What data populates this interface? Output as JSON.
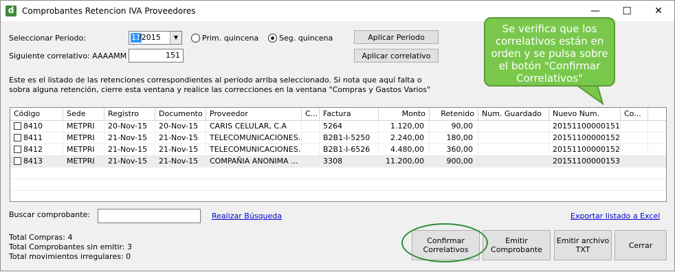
{
  "window": {
    "title": "Comprobantes Retencion IVA Proveedores",
    "app_icon_letter": "d",
    "min_glyph": "—",
    "max_glyph": "☐",
    "close_glyph": "✕"
  },
  "period": {
    "label": "Seleccionar Periodo:",
    "month_selected": "11",
    "year_rest": "/2015",
    "option_first": "Prim. quincena",
    "option_second": "Seg. quincena",
    "selected_option": "second",
    "apply_label": "Aplicar Periodo"
  },
  "correlative": {
    "label": "Siguiente correlativo: AAAAMM",
    "value": "151",
    "apply_label": "Aplicar correlativo"
  },
  "info": {
    "line1": "Este es el listado de las retenciones correspondientes al período arriba seleccionado. Si nota que aquí falta o",
    "line2": "sobra alguna retención, cierre esta ventana y realice las correcciones en la ventana \"Compras y Gastos Varios\""
  },
  "table": {
    "columns": [
      "Código",
      "Sede",
      "Registro",
      "Documento",
      "Proveedor",
      "C...",
      "Factura",
      "Monto",
      "Retenido",
      "Num. Guardado",
      "Nuevo Num.",
      "Co..."
    ],
    "rows": [
      {
        "codigo": "8410",
        "sede": "METPRI",
        "registro": "20-Nov-15",
        "documento": "20-Nov-15",
        "proveedor": "CARIS CELULAR, C.A",
        "c": "",
        "factura": "5264",
        "monto": "1.120,00",
        "retenido": "90,00",
        "num_guardado": "",
        "nuevo_num": "20151100000151",
        "co": ""
      },
      {
        "codigo": "8411",
        "sede": "METPRI",
        "registro": "21-Nov-15",
        "documento": "21-Nov-15",
        "proveedor": "TELECOMUNICACIONES...",
        "c": "",
        "factura": "B2B1-I-5250",
        "monto": "2.240,00",
        "retenido": "180,00",
        "num_guardado": "",
        "nuevo_num": "20151100000152",
        "co": ""
      },
      {
        "codigo": "8412",
        "sede": "METPRI",
        "registro": "21-Nov-15",
        "documento": "21-Nov-15",
        "proveedor": "TELECOMUNICACIONES...",
        "c": "",
        "factura": "B2B1-I-6526",
        "monto": "4.480,00",
        "retenido": "360,00",
        "num_guardado": "",
        "nuevo_num": "20151100000152",
        "co": ""
      },
      {
        "codigo": "8413",
        "sede": "METPRI",
        "registro": "21-Nov-15",
        "documento": "21-Nov-15",
        "proveedor": "COMPAÑIA ANONIMA ...",
        "c": "",
        "factura": "3308",
        "monto": "11.200,00",
        "retenido": "900,00",
        "num_guardado": "",
        "nuevo_num": "20151100000153",
        "co": ""
      }
    ]
  },
  "search": {
    "label": "Buscar comprobante:",
    "value": "",
    "link": "Realizar Búsqueda"
  },
  "export_link": "Exportar listado a Excel",
  "totals": {
    "compras": "Total Compras: 4",
    "sin_emitir": "Total Comprobantes sin emitir: 3",
    "irregulares": "Total movimientos irregulares: 0"
  },
  "buttons": {
    "confirmar_l1": "Confirmar",
    "confirmar_l2": "Correlativos",
    "emitir_l1": "Emitir",
    "emitir_l2": "Comprobante",
    "txt_l1": "Emitir archivo",
    "txt_l2": "TXT",
    "cerrar": "Cerrar"
  },
  "callout": {
    "line1": "Se verifica que los",
    "line2": "correlativos están en",
    "line3": "orden y se pulsa sobre",
    "line4": "el botón \"Confirmar",
    "line5": "Correlativos\""
  },
  "colors": {
    "callout_fill": "#79c84c",
    "highlight_ring": "#2e8b3a",
    "link": "#0000cc",
    "selection": "#3399ff"
  }
}
